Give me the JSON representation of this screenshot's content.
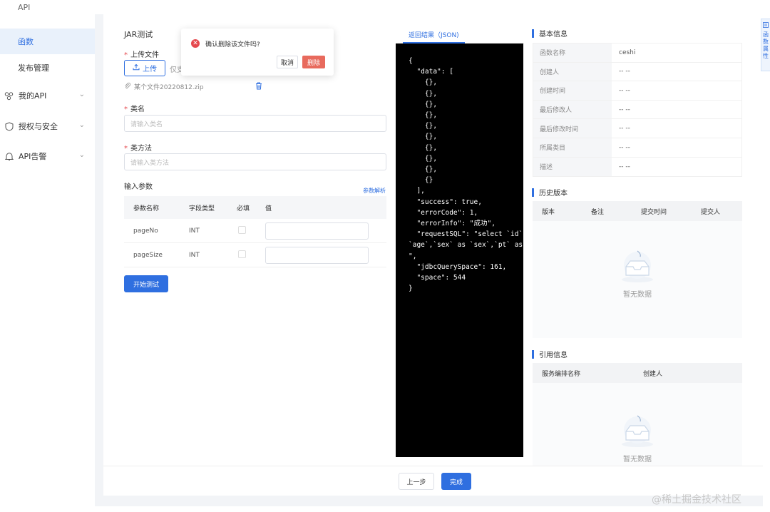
{
  "sidebar": {
    "items": [
      {
        "label": "API"
      },
      {
        "label": "函数"
      },
      {
        "label": "发布管理"
      },
      {
        "label": "我的API"
      },
      {
        "label": "授权与安全"
      },
      {
        "label": "API告警"
      }
    ]
  },
  "form": {
    "title": "JAR测试",
    "upload_label": "上传文件",
    "upload_button": "上传",
    "upload_hint": "仅支",
    "file_name": "某个文件20220812.zip",
    "class_label": "类名",
    "class_placeholder": "请输入类名",
    "method_label": "类方法",
    "method_placeholder": "请输入类方法",
    "params_label": "输入参数",
    "params_link": "参数解析",
    "params_headers": [
      "参数名称",
      "字段类型",
      "必填",
      "值"
    ],
    "params_rows": [
      {
        "name": "pageNo",
        "type": "INT"
      },
      {
        "name": "pageSize",
        "type": "INT"
      }
    ],
    "start_button": "开始测试"
  },
  "popconfirm": {
    "icon": "close-circle-icon",
    "message": "确认删除该文件吗?",
    "cancel": "取消",
    "delete": "删除",
    "delete_color": "#e86a5d"
  },
  "json_panel": {
    "tab": "返回结果（JSON)",
    "lines": [
      "{",
      "  \"data\": [",
      "    {},",
      "    {},",
      "    {},",
      "    {},",
      "    {},",
      "    {},",
      "    {},",
      "    {},",
      "    {},",
      "    {}",
      "  ],",
      "  \"success\": true,",
      "  \"errorCode\": 1,",
      "  \"errorInfo\": \"成功\",",
      "  \"requestSQL\": \"select `id` as",
      "`age`,`sex` as `sex`,`pt` as `pt` f",
      "\",",
      "  \"jdbcQuerySpace\": 161,",
      "  \"space\": 544",
      "}"
    ]
  },
  "info": {
    "basic_title": "基本信息",
    "rows": [
      {
        "key": "函数名称",
        "value": "ceshi"
      },
      {
        "key": "创建人",
        "value": "-- --"
      },
      {
        "key": "创建时间",
        "value": "-- --"
      },
      {
        "key": "最后修改人",
        "value": "-- --"
      },
      {
        "key": "最后修改时间",
        "value": "-- --"
      },
      {
        "key": "所属类目",
        "value": "-- --"
      },
      {
        "key": "描述",
        "value": "-- --"
      }
    ],
    "history_title": "历史版本",
    "history_headers": [
      "版本",
      "备注",
      "提交时间",
      "提交人"
    ],
    "history_empty": "暂无数据",
    "ref_title": "引用信息",
    "ref_headers": [
      "服务编排名称",
      "创建人"
    ],
    "ref_empty": "暂无数据"
  },
  "side_tab": {
    "label": "函数属性"
  },
  "footer": {
    "prev": "上一步",
    "done": "完成"
  },
  "watermark": "@稀土掘金技术社区",
  "colors": {
    "accent": "#2f6fe0",
    "danger": "#e5484d"
  }
}
